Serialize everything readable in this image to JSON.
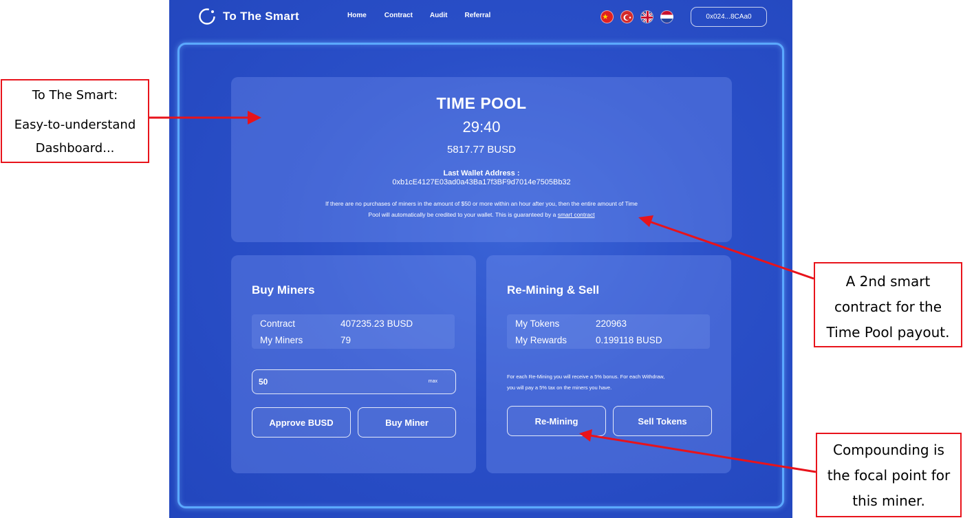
{
  "app": {
    "brand": "To The Smart",
    "nav": [
      "Home",
      "Contract",
      "Audit",
      "Referral"
    ],
    "languages": [
      "chinese-flag",
      "turkish-flag",
      "uk-flag",
      "netherlands-flag"
    ],
    "wallet_button": "0x024...8CAa0"
  },
  "time_pool": {
    "title": "TIME POOL",
    "timer": "29:40",
    "amount": "5817.77 BUSD",
    "last_wallet_label": "Last Wallet Address :",
    "last_wallet_address": "0xb1cE4127E03ad0a43Ba17f3BF9d7014e7505Bb32",
    "notice_line1": "If there are no purchases of miners in the amount of $50 or more within an hour after you, then the entire amount of Time",
    "notice_line2": "Pool will automatically be credited to your wallet. This is guaranteed by a",
    "notice_link": "smart contract"
  },
  "buy_miners": {
    "title": "Buy Miners",
    "stats": [
      {
        "label": "Contract",
        "value": "407235.23 BUSD"
      },
      {
        "label": "My Miners",
        "value": "79"
      }
    ],
    "input_value": "50",
    "max_label": "max",
    "approve_button": "Approve BUSD",
    "buy_button": "Buy Miner"
  },
  "remining": {
    "title": "Re-Mining & Sell",
    "stats": [
      {
        "label": "My Tokens",
        "value": "220963"
      },
      {
        "label": "My Rewards",
        "value": "0.199118 BUSD"
      }
    ],
    "note_line1": "For each Re-Mining you will receive a 5% bonus. For each Withdraw,",
    "note_line2": "you will pay a 5% tax on the miners you have.",
    "remining_button": "Re-Mining",
    "sell_button": "Sell Tokens"
  },
  "annotations": {
    "box1_line1": "To The Smart:",
    "box1_line2": "Easy-to-understand",
    "box1_line3": "Dashboard...",
    "box2_lines": [
      "A 2nd smart",
      "contract for the",
      "Time Pool payout."
    ],
    "box3_lines": [
      "Compounding is",
      "the focal point for",
      "this miner."
    ]
  },
  "colors": {
    "background": "#2a4fc8",
    "frame": "#5ba9ff",
    "annotation_red": "#e8131b"
  }
}
